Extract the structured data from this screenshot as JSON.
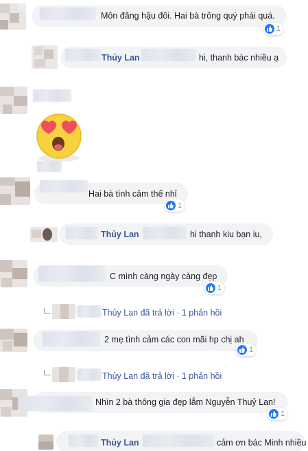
{
  "comments": [
    {
      "text": "Môn đăng hậu đối. Hai bà trông quý phái quá.",
      "likes": "1"
    },
    {
      "author": "Thủy Lan",
      "text": "hi, thanh bác nhiều ạ"
    },
    {
      "sticker": "heart-eyes-emoji"
    },
    {
      "text": "Hai bà tình cảm thế nhỉ",
      "likes": "1"
    },
    {
      "author": "Thủy Lan",
      "text": "hi thanh kiu bạn iu,"
    },
    {
      "text": "C mình càng ngày càng đẹp",
      "likes": "1",
      "reply_summary": "Thủy Lan đã trả lời · 1 phản hồi"
    },
    {
      "text": "2 mẹ tình cảm các con mãi hp chị ah",
      "likes": "1",
      "reply_summary": "Thủy Lan đã trả lời · 1 phản hồi"
    },
    {
      "text": "Nhìn 2 bà thông gia đẹp lắm Nguyễn Thuỷ Lan!",
      "likes": "1"
    },
    {
      "author": "Thủy Lan",
      "text": "cảm ơn bác Minh nhiều ạ"
    }
  ],
  "icons": {
    "like": "like-icon",
    "reply": "reply-arrow-icon",
    "sticker": "heart-eyes-emoji"
  },
  "colors": {
    "bubble": "#f2f3f5",
    "author": "#365899",
    "like": "#2078f4"
  }
}
